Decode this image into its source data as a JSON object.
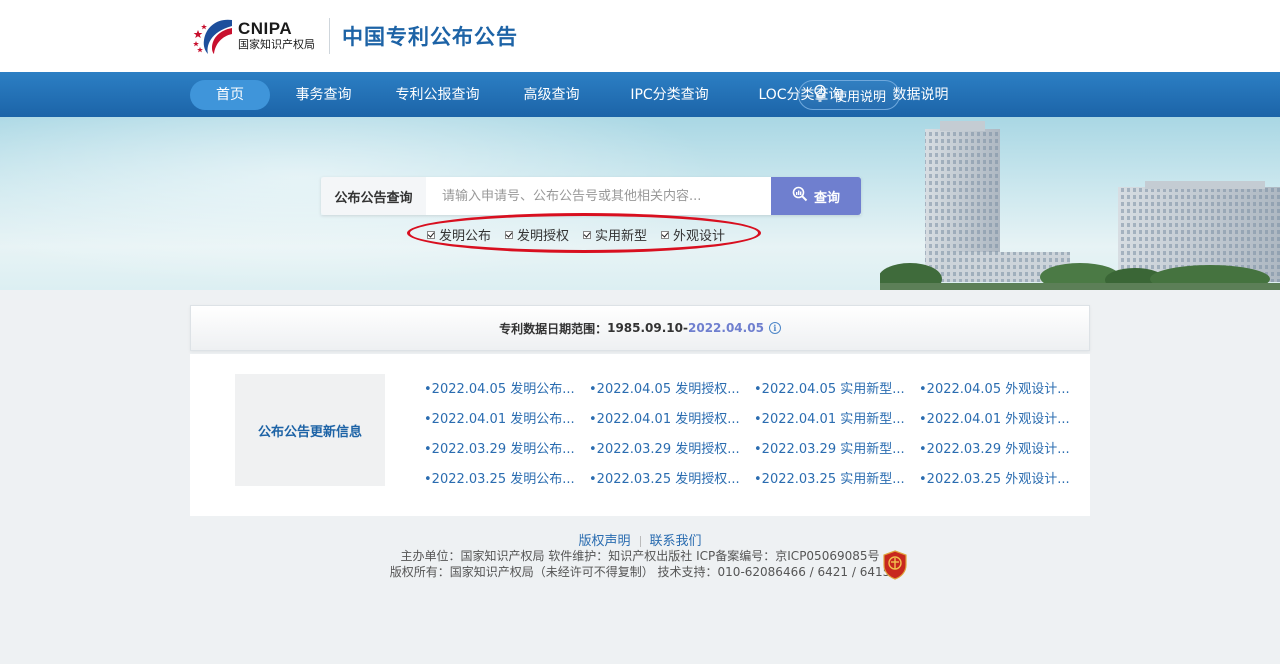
{
  "header": {
    "logo_en": "CNIPA",
    "logo_cn": "国家知识产权局",
    "site_title": "中国专利公布公告"
  },
  "nav": {
    "items": [
      "首页",
      "事务查询",
      "专利公报查询",
      "高级查询",
      "IPC分类查询",
      "LOC分类查询",
      "数据说明"
    ],
    "active": "首页",
    "help_label": "使用说明"
  },
  "search": {
    "label": "公布公告查询",
    "placeholder": "请输入申请号、公布公告号或其他相关内容...",
    "button_label": "查询",
    "options": [
      {
        "label": "发明公布",
        "checked": true
      },
      {
        "label": "发明授权",
        "checked": true
      },
      {
        "label": "实用新型",
        "checked": true
      },
      {
        "label": "外观设计",
        "checked": true
      }
    ],
    "highlight_color": "#d80f1f"
  },
  "range": {
    "label": "专利数据日期范围：",
    "start": "1985.09.10",
    "dash": "-",
    "end": "2022.04.05"
  },
  "updates": {
    "title": "公布公告更新信息",
    "rows": [
      [
        "•2022.04.05 发明公布...",
        "•2022.04.05 发明授权...",
        "•2022.04.05 实用新型...",
        "•2022.04.05 外观设计..."
      ],
      [
        "•2022.04.01 发明公布...",
        "•2022.04.01 发明授权...",
        "•2022.04.01 实用新型...",
        "•2022.04.01 外观设计..."
      ],
      [
        "•2022.03.29 发明公布...",
        "•2022.03.29 发明授权...",
        "•2022.03.29 实用新型...",
        "•2022.03.29 外观设计..."
      ],
      [
        "•2022.03.25 发明公布...",
        "•2022.03.25 发明授权...",
        "•2022.03.25 实用新型...",
        "•2022.03.25 外观设计..."
      ]
    ]
  },
  "footer": {
    "links": [
      "版权声明",
      "联系我们"
    ],
    "line1": "主办单位：国家知识产权局    软件维护：知识产权出版社    ICP备案编号：京ICP05069085号",
    "line2": "版权所有：国家知识产权局（未经许可不得复制）    技术支持：010-62086466 / 6421 / 6415"
  },
  "colors": {
    "brand_blue": "#1d63a6",
    "nav_bg": "#1c64a8",
    "nav_active": "#3f95da",
    "search_button": "#6f7fcf",
    "link": "#2a6cb0"
  }
}
